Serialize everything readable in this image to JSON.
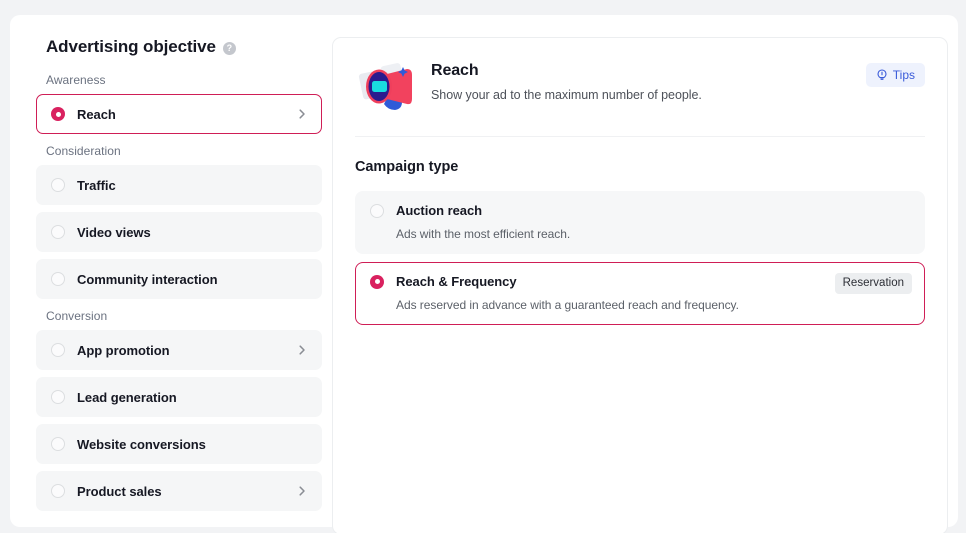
{
  "colors": {
    "accent": "#d9215f",
    "accent_border": "#cf1e56",
    "page_bg": "#f2f3f5",
    "item_bg": "#f5f6f7",
    "tips_bg": "#eef2fd",
    "tips_fg": "#3a5bd9",
    "badge_bg": "#eceef0"
  },
  "sidebar": {
    "title": "Advertising objective",
    "help_icon": "question-mark-circle-icon",
    "groups": [
      {
        "label": "Awareness",
        "items": [
          {
            "label": "Reach",
            "selected": true,
            "chevron": true
          }
        ]
      },
      {
        "label": "Consideration",
        "items": [
          {
            "label": "Traffic",
            "selected": false,
            "chevron": false
          },
          {
            "label": "Video views",
            "selected": false,
            "chevron": false
          },
          {
            "label": "Community interaction",
            "selected": false,
            "chevron": false
          }
        ]
      },
      {
        "label": "Conversion",
        "items": [
          {
            "label": "App promotion",
            "selected": false,
            "chevron": true
          },
          {
            "label": "Lead generation",
            "selected": false,
            "chevron": false
          },
          {
            "label": "Website conversions",
            "selected": false,
            "chevron": false
          },
          {
            "label": "Product sales",
            "selected": false,
            "chevron": true
          }
        ]
      }
    ]
  },
  "detail": {
    "icon": "megaphone-icon",
    "title": "Reach",
    "subtitle": "Show your ad to the maximum number of people.",
    "tips_label": "Tips",
    "tips_icon": "lightbulb-icon",
    "campaign_type_title": "Campaign type",
    "options": [
      {
        "label": "Auction reach",
        "description": "Ads with the most efficient reach.",
        "selected": false,
        "badge": null
      },
      {
        "label": "Reach & Frequency",
        "description": "Ads reserved in advance with a guaranteed reach and frequency.",
        "selected": true,
        "badge": "Reservation"
      }
    ]
  }
}
